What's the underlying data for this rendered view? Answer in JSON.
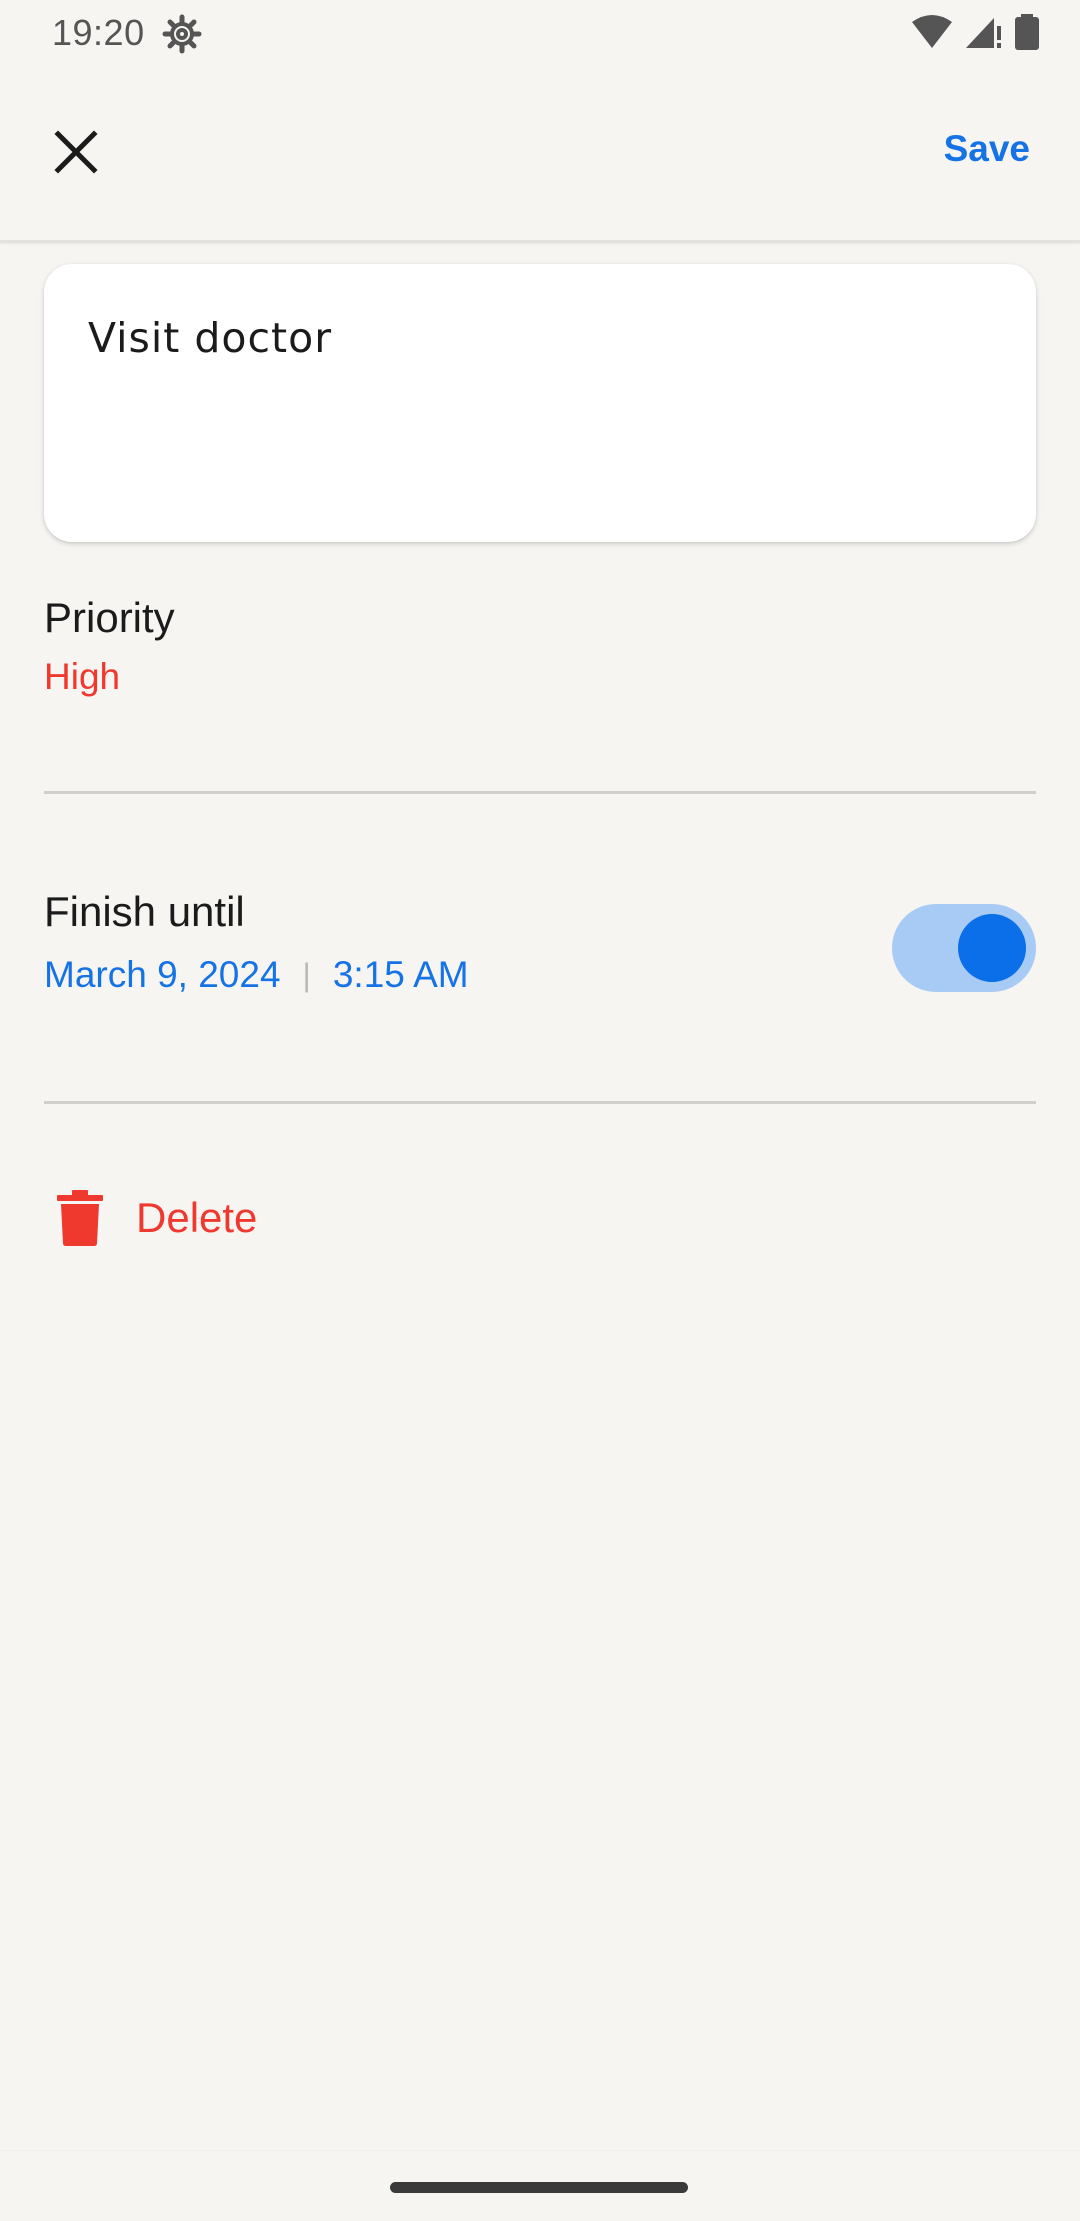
{
  "status_bar": {
    "time": "19:20",
    "icons": [
      "settings-gear-icon",
      "wifi-icon",
      "signal-icon",
      "battery-icon"
    ]
  },
  "app_bar": {
    "close_icon": "close-icon",
    "save_label": "Save"
  },
  "task": {
    "title": "Visit doctor"
  },
  "priority": {
    "label": "Priority",
    "value": "High"
  },
  "finish": {
    "label": "Finish until",
    "date": "March 9, 2024",
    "separator": "|",
    "time": "3:15 AM",
    "enabled": true
  },
  "delete": {
    "label": "Delete",
    "icon": "trash-icon"
  },
  "colors": {
    "accent": "#1673e6",
    "danger": "#f0392e",
    "background": "#f6f5f2",
    "toggle_track": "#a8cbf5",
    "toggle_knob": "#0a6fe8"
  }
}
